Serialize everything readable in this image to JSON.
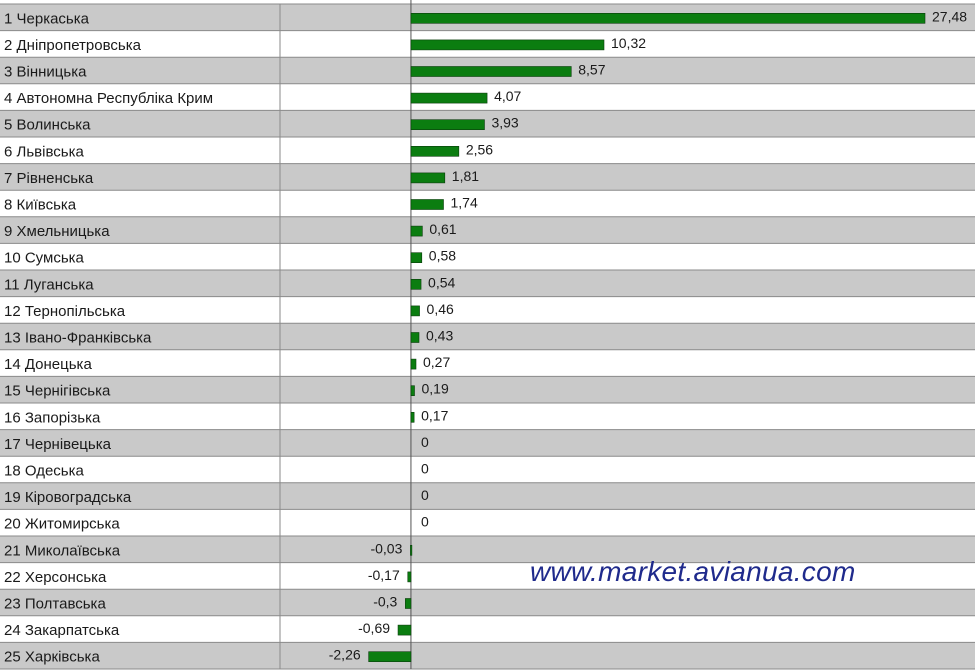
{
  "chart_data": {
    "type": "bar",
    "orientation": "horizontal",
    "categories": [
      "1 Черкаська",
      "2 Дніпропетровська",
      "3 Вінницька",
      "4 Автономна Республіка Крим",
      "5 Волинська",
      "6 Львівська",
      "7 Рівненська",
      "8 Київська",
      "9 Хмельницька",
      "10 Сумська",
      "11 Луганська",
      "12 Тернопільська",
      "13 Івано-Франківська",
      "14 Донецька",
      "15 Чернігівська",
      "16 Запорізька",
      "17 Чернівецька",
      "18 Одеська",
      "19 Кіровоградська",
      "20 Житомирська",
      "21 Миколаївська",
      "22 Херсонська",
      "23 Полтавська",
      "24 Закарпатська",
      "25 Харківська"
    ],
    "values": [
      27.48,
      10.32,
      8.57,
      4.07,
      3.93,
      2.56,
      1.81,
      1.74,
      0.61,
      0.58,
      0.54,
      0.46,
      0.43,
      0.27,
      0.19,
      0.17,
      0,
      0,
      0,
      0,
      -0.03,
      -0.17,
      -0.3,
      -0.69,
      -2.26
    ],
    "value_labels": [
      "27,48",
      "10,32",
      "8,57",
      "4,07",
      "3,93",
      "2,56",
      "1,81",
      "1,74",
      "0,61",
      "0,58",
      "0,54",
      "0,46",
      "0,43",
      "0,27",
      "0,19",
      "0,17",
      "0",
      "0",
      "0",
      "0",
      "-0,03",
      "-0,17",
      "-0,3",
      "-0,69",
      "-2,26"
    ],
    "xlim": [
      -7,
      27.48
    ],
    "grid": false,
    "legend": "none",
    "row_shading": "alternating",
    "colors": {
      "bar": "#0b7d10",
      "bar_stroke": "#0a3d0c",
      "row_dark": "#c9c9c9",
      "row_light": "#ffffff",
      "grid_line": "#8a8a8a",
      "zero_line": "#555555"
    }
  },
  "watermark": "www.market.avianua.com"
}
